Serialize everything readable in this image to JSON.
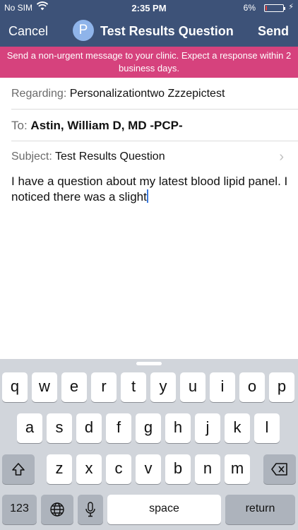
{
  "status_bar": {
    "carrier": "No SIM",
    "time": "2:35 PM",
    "battery_percent": "6%",
    "battery_level": 0.06
  },
  "nav": {
    "cancel_label": "Cancel",
    "avatar_initial": "P",
    "title": "Test Results Question",
    "send_label": "Send"
  },
  "banner": {
    "text": "Send a non-urgent message to your clinic. Expect a response within 2 business days."
  },
  "form": {
    "regarding_label": "Regarding:",
    "regarding_value": "Personalizationtwo Zzzepictest",
    "to_label": "To:",
    "to_value": "Astin, William D, MD -PCP-",
    "subject_label": "Subject:",
    "subject_value": "Test Results Question"
  },
  "message": {
    "body": "I have a question about my latest blood lipid panel. I noticed there was a slight"
  },
  "keyboard": {
    "row1": [
      "q",
      "w",
      "e",
      "r",
      "t",
      "y",
      "u",
      "i",
      "o",
      "p"
    ],
    "row2": [
      "a",
      "s",
      "d",
      "f",
      "g",
      "h",
      "j",
      "k",
      "l"
    ],
    "row3": [
      "z",
      "x",
      "c",
      "v",
      "b",
      "n",
      "m"
    ],
    "numbers_label": "123",
    "space_label": "space",
    "return_label": "return"
  },
  "colors": {
    "nav_bg": "#3d5278",
    "banner_bg": "#d6427d",
    "avatar_bg": "#8fb4ea",
    "cursor": "#3c7be0",
    "battery_low": "#e0413c"
  }
}
